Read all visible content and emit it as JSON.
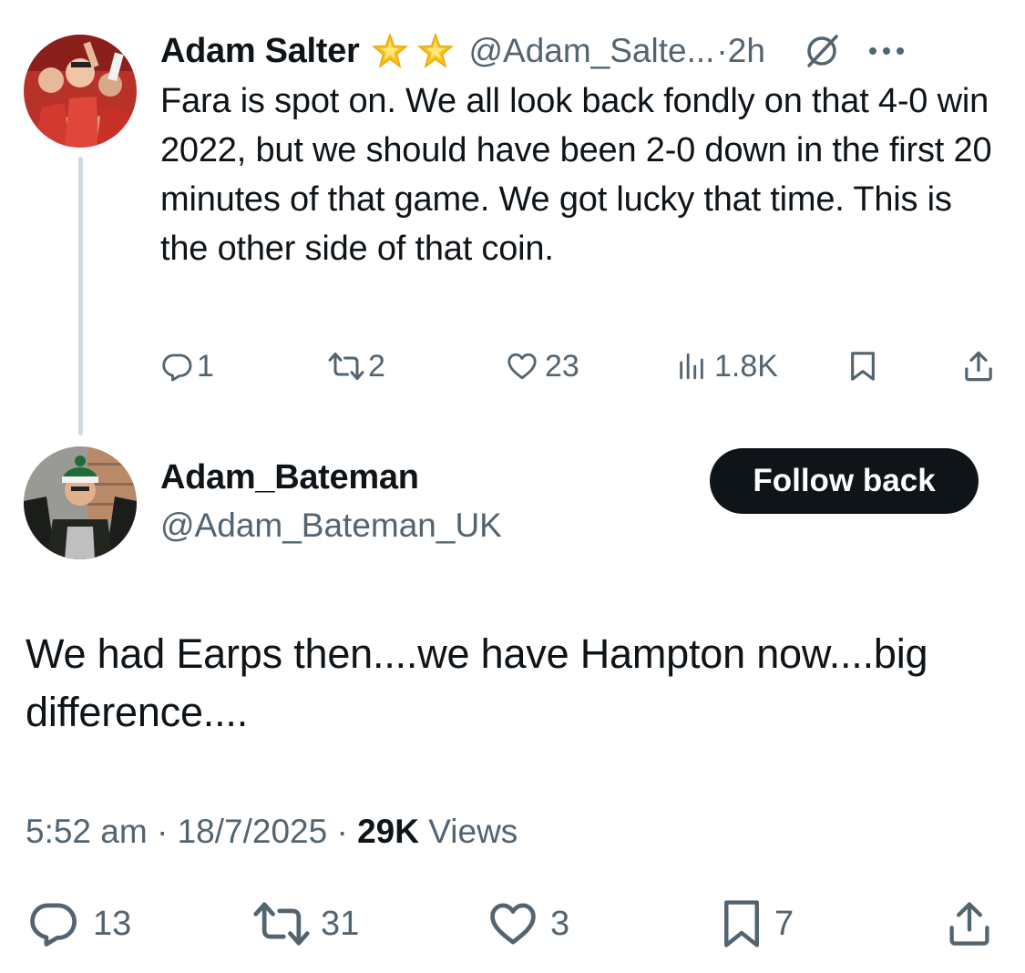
{
  "parent_tweet": {
    "display_name": "Adam Salter",
    "badges": [
      "glowing-star-icon",
      "glowing-star-icon"
    ],
    "handle": "@Adam_Salte...",
    "separator": "·",
    "time": "2h",
    "text": "Fara is spot on. We all look back fondly on that 4-0 win 2022, but we should have been 2-0 down in the first 20 minutes of that game. We got lucky that time. This is the other side of that coin.",
    "replies": "1",
    "reposts": "2",
    "likes": "23",
    "views": "1.8K"
  },
  "main_tweet": {
    "display_name": "Adam_Bateman",
    "handle": "@Adam_Bateman_UK",
    "follow_label": "Follow back",
    "text": "We had Earps then....we have Hampton now....big difference....",
    "time": "5:52 am",
    "sep1": "·",
    "date": "18/7/2025",
    "sep2": "·",
    "views_count": "29K",
    "views_label": "Views",
    "replies": "13",
    "reposts": "31",
    "likes": "3",
    "bookmarks": "7"
  },
  "colors": {
    "text": "#0f1419",
    "secondary": "#536471",
    "thread_line": "#cfd9de",
    "button_bg": "#0f1419",
    "star": "#f5c518"
  }
}
